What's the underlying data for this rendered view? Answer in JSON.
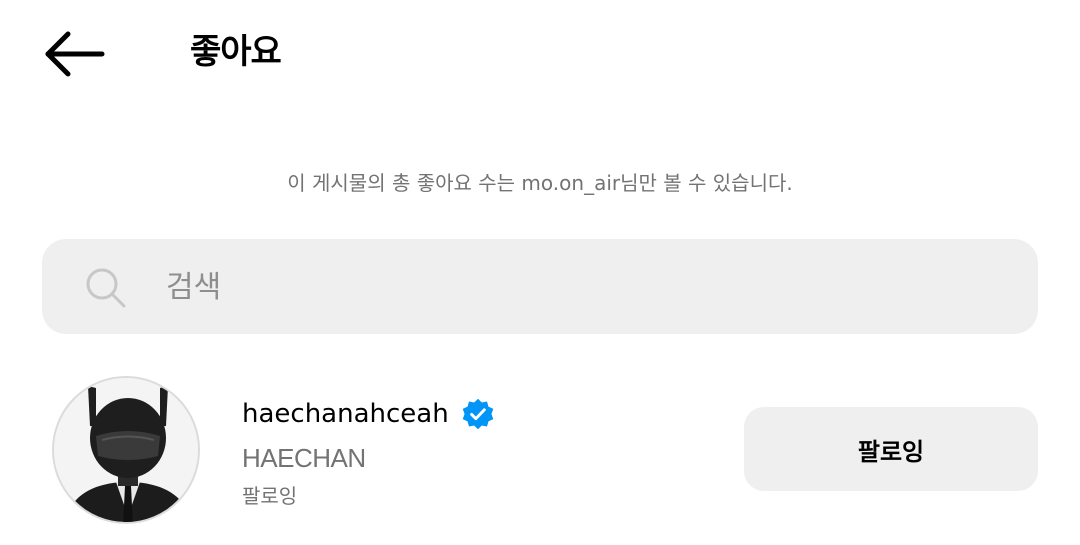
{
  "header": {
    "back_icon": "arrow-left-icon",
    "title": "좋아요"
  },
  "notice": "이 게시물의 총 좋아요 수는 mo.on_air님만 볼 수 있습니다.",
  "search": {
    "icon": "search-icon",
    "placeholder": "검색",
    "value": ""
  },
  "users": [
    {
      "username": "haechanahceah",
      "verified": true,
      "full_name": "HAECHAN",
      "status": "팔로잉",
      "follow_button_label": "팔로잉"
    }
  ],
  "colors": {
    "verified_badge": "#0095f6",
    "secondary_text": "#737373",
    "input_background": "#efefef"
  }
}
